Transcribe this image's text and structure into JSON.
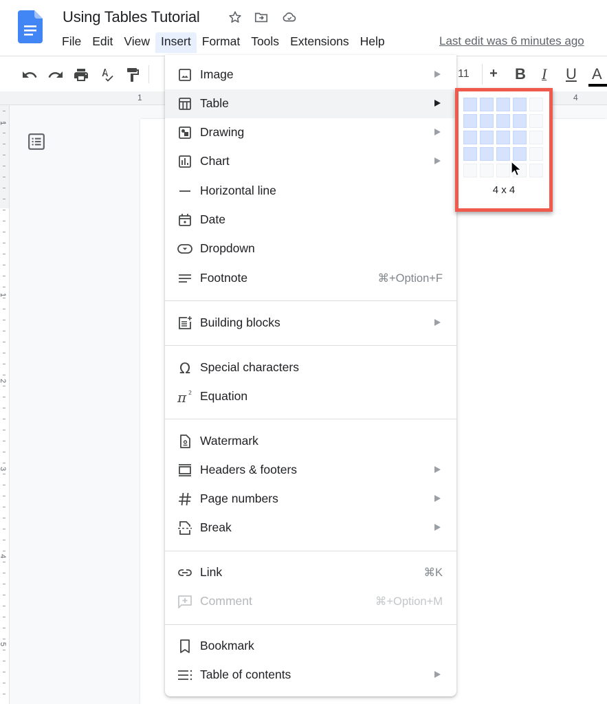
{
  "app": {
    "title": "Using Tables Tutorial",
    "brand_color": "#4285f4",
    "highlight_color": "#ef5a4c"
  },
  "header": {
    "icons": [
      "docs-logo-icon",
      "star-icon",
      "move-folder-icon",
      "cloud-saved-icon"
    ],
    "menu": [
      "File",
      "Edit",
      "View",
      "Insert",
      "Format",
      "Tools",
      "Extensions",
      "Help"
    ],
    "active_menu": "Insert",
    "last_edit": "Last edit was 6 minutes ago"
  },
  "toolbar": {
    "icons": [
      "undo-icon",
      "redo-icon",
      "print-icon",
      "spellcheck-icon",
      "paint-format-icon"
    ],
    "font_size": "11",
    "increase_font": "+",
    "bold": "B",
    "italic": "I",
    "underline": "U",
    "text_color": "A"
  },
  "ruler": {
    "horizontal_labels": [
      "1",
      "4"
    ],
    "vertical_labels": [
      "1",
      "1",
      "2",
      "3",
      "4",
      "5"
    ]
  },
  "insert_menu": {
    "items": [
      {
        "label": "Image",
        "icon": "image-icon",
        "submenu": true
      },
      {
        "label": "Table",
        "icon": "table-icon",
        "submenu": true,
        "highlighted": true
      },
      {
        "label": "Drawing",
        "icon": "drawing-icon",
        "submenu": true
      },
      {
        "label": "Chart",
        "icon": "chart-icon",
        "submenu": true
      },
      {
        "label": "Horizontal line",
        "icon": "horizontal-line-icon"
      },
      {
        "label": "Date",
        "icon": "calendar-icon"
      },
      {
        "label": "Dropdown",
        "icon": "dropdown-icon"
      },
      {
        "label": "Footnote",
        "icon": "footnote-icon",
        "shortcut": "⌘+Option+F"
      },
      {
        "label": "Building blocks",
        "icon": "building-blocks-icon",
        "submenu": true
      },
      {
        "label": "Special characters",
        "icon": "omega-icon"
      },
      {
        "label": "Equation",
        "icon": "pi-icon"
      },
      {
        "label": "Watermark",
        "icon": "watermark-icon"
      },
      {
        "label": "Headers & footers",
        "icon": "headers-footers-icon",
        "submenu": true
      },
      {
        "label": "Page numbers",
        "icon": "hash-icon",
        "submenu": true
      },
      {
        "label": "Break",
        "icon": "page-break-icon",
        "submenu": true
      },
      {
        "label": "Link",
        "icon": "link-icon",
        "shortcut": "⌘K"
      },
      {
        "label": "Comment",
        "icon": "add-comment-icon",
        "shortcut": "⌘+Option+M",
        "disabled": true
      },
      {
        "label": "Bookmark",
        "icon": "bookmark-icon"
      },
      {
        "label": "Table of contents",
        "icon": "table-of-contents-icon",
        "submenu": true
      }
    ]
  },
  "table_grid": {
    "columns_shown": 5,
    "rows_shown": 5,
    "selected_columns": 4,
    "selected_rows": 4,
    "label": "4 x 4"
  }
}
